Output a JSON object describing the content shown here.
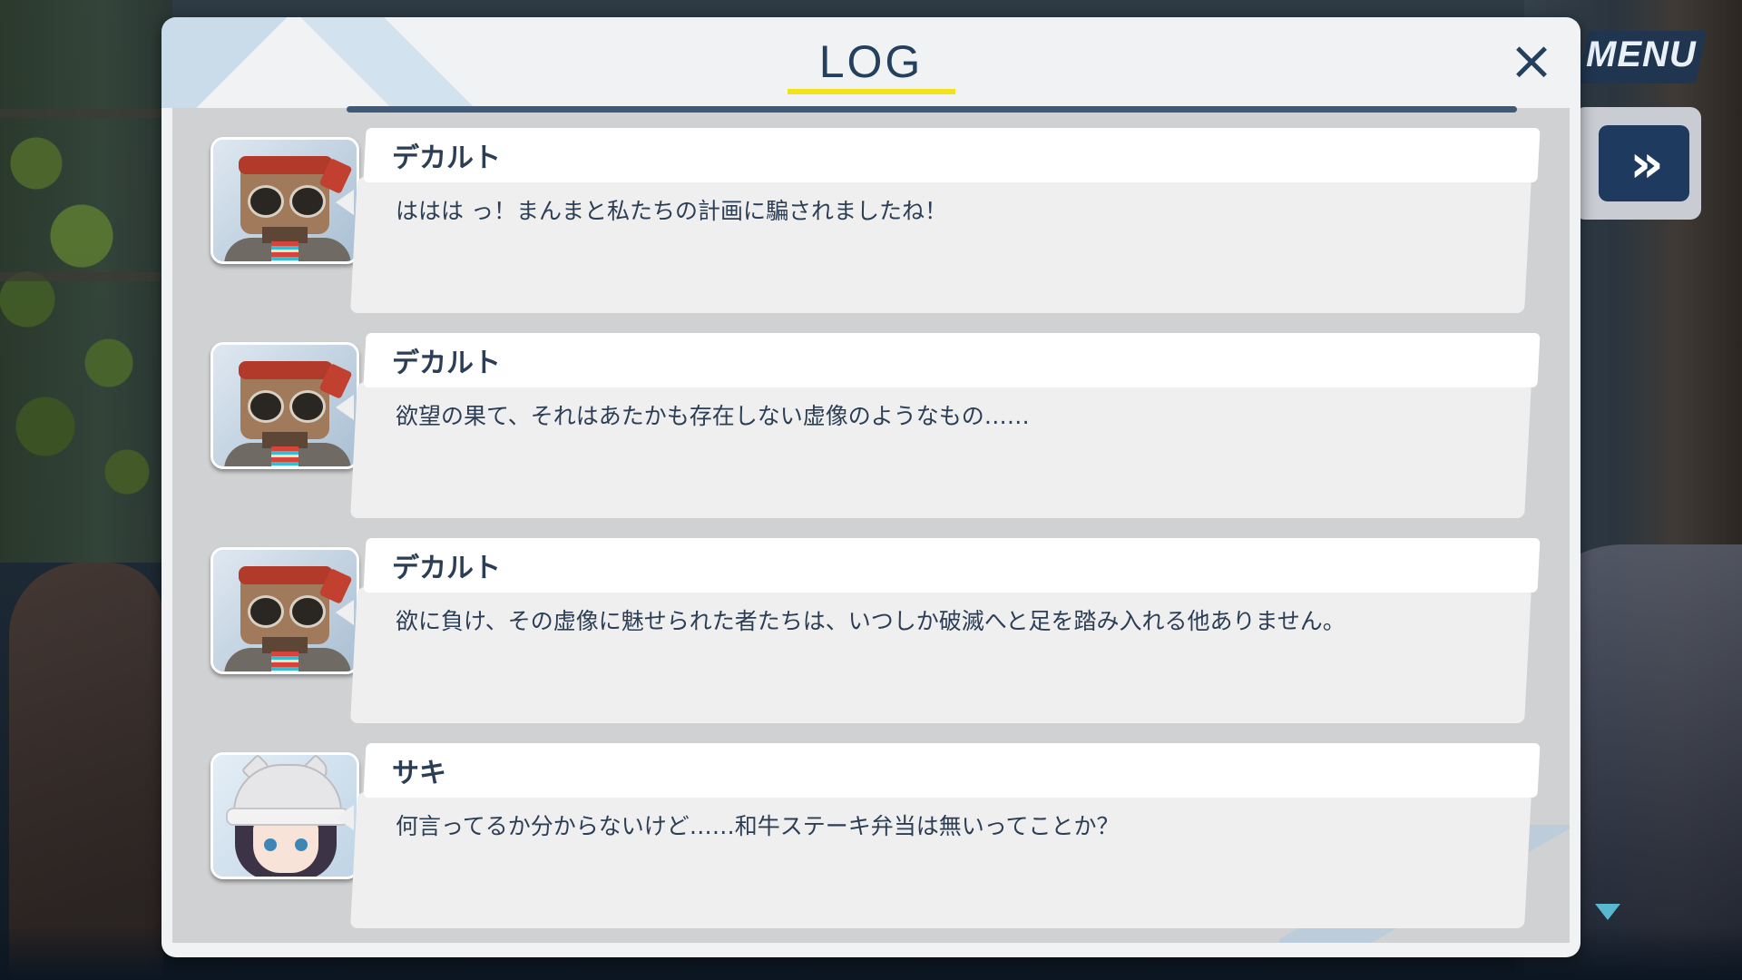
{
  "header": {
    "title": "LOG",
    "close_icon": "×",
    "accent_color": "#f2e21a",
    "title_color": "#23405f"
  },
  "hud": {
    "menu_label": "MENU",
    "fast_forward_glyph": "»"
  },
  "entries": [
    {
      "speaker": "デカルト",
      "avatar": "robot-portrait",
      "text": "ははは っ！まんまと私たちの計画に騙されましたね！"
    },
    {
      "speaker": "デカルト",
      "avatar": "robot-portrait",
      "text": "欲望の果て、それはあたかも存在しない虚像のようなもの……"
    },
    {
      "speaker": "デカルト",
      "avatar": "robot-portrait",
      "text": "欲に負け、その虚像に魅せられた者たちは、いつしか破滅へと足を踏み入れる他ありません。"
    },
    {
      "speaker": "サキ",
      "avatar": "girl-portrait",
      "text": "何言ってるか分からないけど……和牛ステーキ弁当は無いってことか？"
    }
  ]
}
